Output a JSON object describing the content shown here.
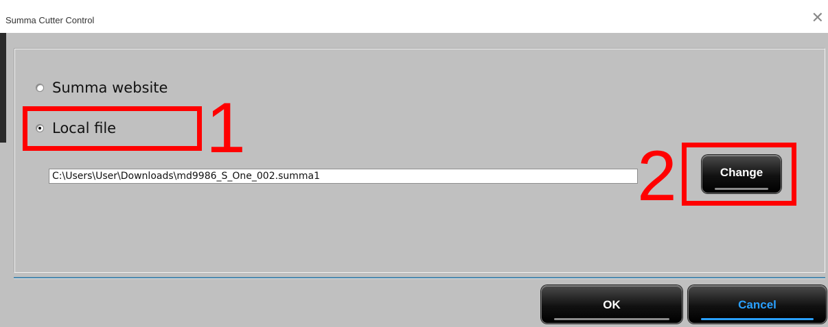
{
  "window": {
    "title": "Summa Cutter Control",
    "close_icon": "close-icon"
  },
  "source_options": [
    {
      "label": "Summa website",
      "selected": false
    },
    {
      "label": "Local file",
      "selected": true
    }
  ],
  "file_path": {
    "value": "C:\\Users\\User\\Downloads\\md9986_S_One_002.summa1"
  },
  "buttons": {
    "change": "Change",
    "ok": "OK",
    "cancel": "Cancel"
  },
  "annotations": {
    "first": "1",
    "second": "2"
  },
  "colors": {
    "annotation": "#ff0000",
    "cancel_text": "#2aa0ff",
    "separator": "#4b8ab0"
  }
}
